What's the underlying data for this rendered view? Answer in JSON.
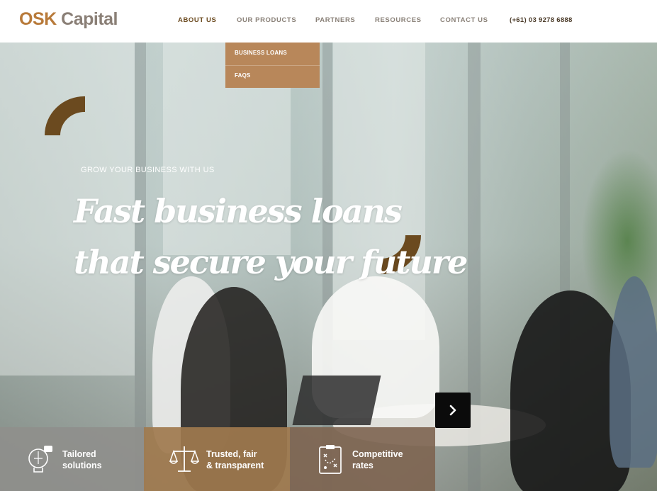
{
  "header": {
    "logo_primary": "OSK",
    "logo_secondary": "Capital",
    "nav": [
      {
        "label": "ABOUT US"
      },
      {
        "label": "OUR PRODUCTS"
      },
      {
        "label": "PARTNERS"
      },
      {
        "label": "RESOURCES"
      },
      {
        "label": "CONTACT US"
      }
    ],
    "phone": "(+61) 03 9278 6888"
  },
  "dropdown": {
    "items": [
      {
        "label": "BUSINESS LOANS"
      },
      {
        "label": "FAQS"
      }
    ]
  },
  "hero": {
    "eyebrow": "GROW YOUR BUSINESS WITH US",
    "headline_line1": "Fast business loans",
    "headline_line2": "that secure your future",
    "next_icon": "chevron-right-icon"
  },
  "features": [
    {
      "label": "Tailored\nsolutions",
      "icon": "lightbulb-gear-icon"
    },
    {
      "label": "Trusted, fair\n& transparent",
      "icon": "scales-icon"
    },
    {
      "label": "Competitive\nrates",
      "icon": "clipboard-strategy-icon"
    }
  ],
  "colors": {
    "brand_gold": "#b87a3a",
    "brand_grey": "#8a7f76",
    "dropdown_bg": "#b8875a",
    "arc_brown": "#6b4a1f",
    "feature_1_bg": "#8f8f8c",
    "feature_2_bg": "#a07a4e",
    "feature_3_bg": "#7d6450",
    "next_button_bg": "#0b0b0b"
  }
}
